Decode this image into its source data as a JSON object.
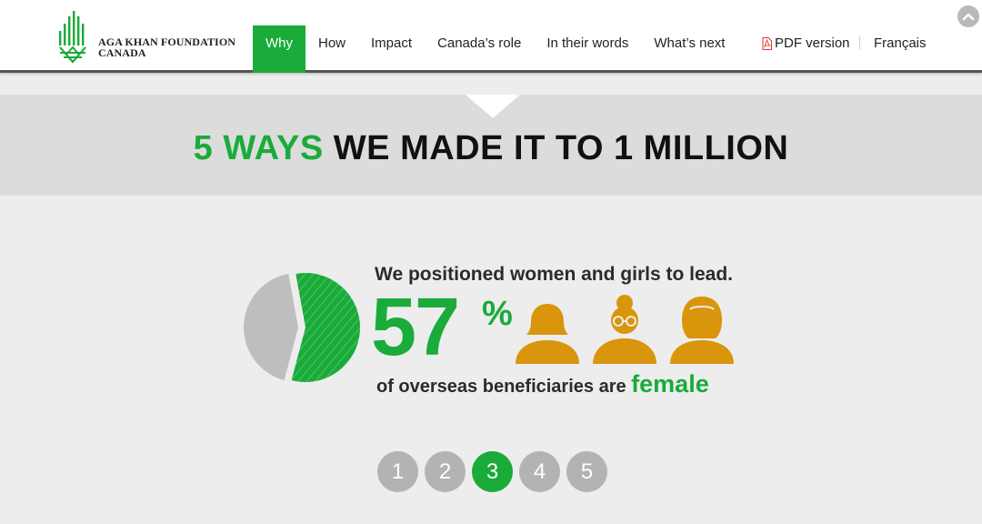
{
  "header": {
    "logo_line1": "AGA KHAN FOUNDATION",
    "logo_line2": "CANADA",
    "nav": [
      "Why",
      "How",
      "Impact",
      "Canada’s role",
      "In their words",
      "What’s next"
    ],
    "active_nav": "Why",
    "pdf_label": "PDF version",
    "language_label": "Français"
  },
  "section": {
    "title_highlight": "5 WAYS",
    "title_rest": "WE MADE IT TO 1 MILLION"
  },
  "infographic": {
    "headline": "We positioned women and girls to lead.",
    "stat_value": "57",
    "stat_unit": "%",
    "caption_prefix": "of overseas beneficiaries are",
    "caption_emphasis": "female",
    "female_share": 0.57
  },
  "pager": {
    "pages": [
      "1",
      "2",
      "3",
      "4",
      "5"
    ],
    "active": "3"
  },
  "colors": {
    "accent_green": "#1aab3a",
    "icon_gold": "#d9950b",
    "pie_gray": "#bdbec0",
    "pager_gray": "#b3b3b3"
  }
}
